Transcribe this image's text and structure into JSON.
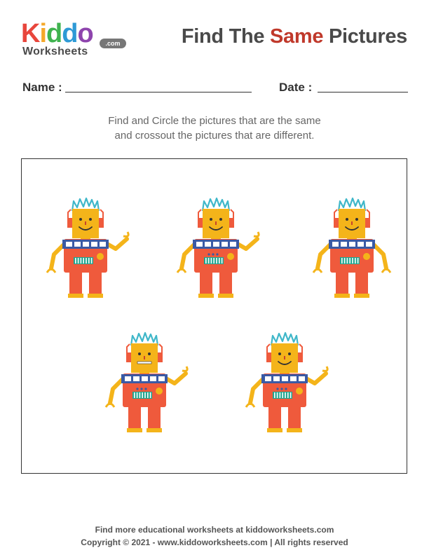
{
  "logo": {
    "letters": [
      "K",
      "i",
      "d",
      "d",
      "o"
    ],
    "letter_colors": [
      "#e8463c",
      "#f4a829",
      "#3fb34f",
      "#2e9ad6",
      "#8e44ad"
    ],
    "subtitle": "Worksheets",
    "domain": ".com"
  },
  "title": {
    "prefix": "Find The",
    "accent": "Same",
    "suffix": "Pictures",
    "accent_color": "#c0392b"
  },
  "fields": {
    "name_label": "Name :",
    "date_label": "Date :"
  },
  "instructions": [
    "Find and Circle the pictures that are the same",
    "and crossout the pictures that are different."
  ],
  "robot_colors": {
    "hair": "#3fb7c9",
    "head": "#f4b41a",
    "body": "#ef5a3c",
    "band": "#3a5aa5",
    "limbs": "#f4b41a",
    "panel": "#1fa58f",
    "feet": "#f4b41a"
  },
  "robots": [
    {
      "id": "robot-1",
      "mouth": "smile",
      "right_arm": "raised",
      "left_arm": "down",
      "dots": 0
    },
    {
      "id": "robot-2",
      "mouth": "smile",
      "right_arm": "raised",
      "left_arm": "down",
      "dots": 3
    },
    {
      "id": "robot-3",
      "mouth": "smile",
      "right_arm": "down",
      "left_arm": "down",
      "dots": 0
    },
    {
      "id": "robot-4",
      "mouth": "flat",
      "right_arm": "raised",
      "left_arm": "down",
      "dots": 3
    },
    {
      "id": "robot-5",
      "mouth": "smile",
      "right_arm": "raised",
      "left_arm": "down",
      "dots": 3
    }
  ],
  "footer": {
    "line1": "Find more educational worksheets at kiddoworksheets.com",
    "line2": "Copyright © 2021 - www.kiddoworksheets.com  |  All rights reserved"
  }
}
